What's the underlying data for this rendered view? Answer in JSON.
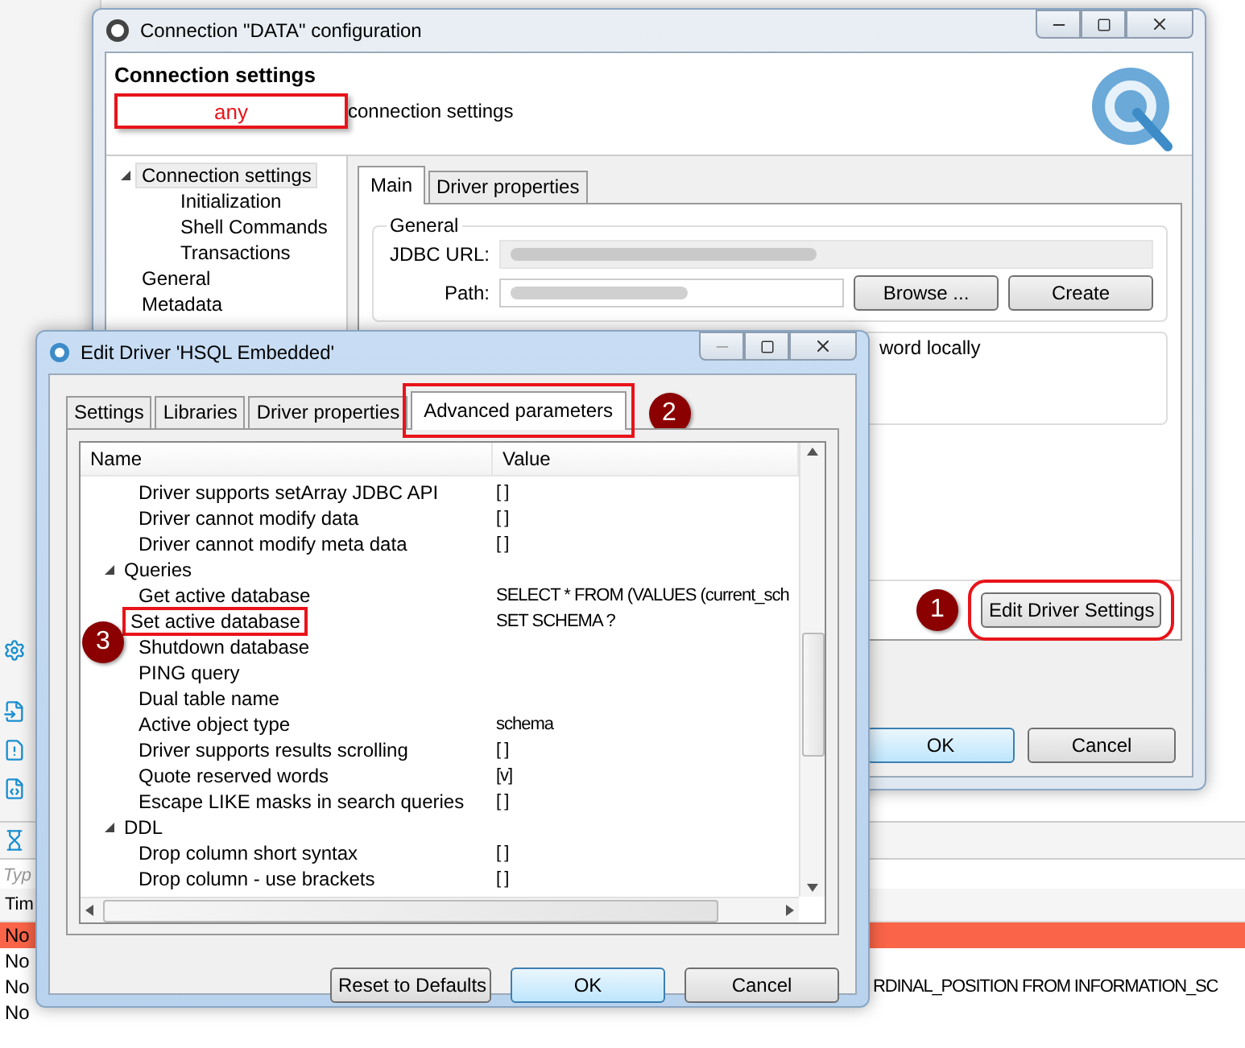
{
  "log_panel": {
    "filter_placeholder": "Typ",
    "columns": [
      "Tim"
    ],
    "rows": [
      {
        "time": "No",
        "query": "",
        "selected": true
      },
      {
        "time": "No",
        "query": "",
        "selected": false
      },
      {
        "time": "No",
        "query": "RDINAL_POSITION FROM INFORMATION_SC",
        "selected": false
      },
      {
        "time": "No",
        "query": "",
        "selected": false
      }
    ]
  },
  "connection_window": {
    "title": "Connection \"DATA\" configuration",
    "header_title": "Connection settings",
    "header_highlight": "any",
    "header_subtitle": "connection settings",
    "nav": [
      {
        "label": "Connection settings",
        "expanded": true,
        "selected": true,
        "children": [
          {
            "label": "Initialization",
            "selected": false
          },
          {
            "label": "Shell Commands",
            "selected": false
          },
          {
            "label": "Transactions",
            "selected": false
          }
        ]
      },
      {
        "label": "General",
        "selected": false
      },
      {
        "label": "Metadata",
        "selected": false
      }
    ],
    "tabs": [
      {
        "label": "Main",
        "selected": true
      },
      {
        "label": "Driver properties",
        "selected": false
      }
    ],
    "general_group": {
      "title": "General",
      "jdbc_label": "JDBC URL:",
      "path_label": "Path:",
      "buttons": [
        "Browse ...",
        "Create"
      ]
    },
    "auth_group_text": "word locally",
    "badge": "1",
    "edit_driver_button": "Edit Driver Settings",
    "buttons": [
      {
        "label": "OK",
        "default": true
      },
      {
        "label": "Cancel",
        "default": false
      }
    ]
  },
  "driver_window": {
    "title": "Edit Driver 'HSQL Embedded'",
    "tabs": [
      {
        "label": "Settings",
        "selected": false,
        "highlighted": false
      },
      {
        "label": "Libraries",
        "selected": false,
        "highlighted": false
      },
      {
        "label": "Driver properties",
        "selected": false,
        "highlighted": false
      },
      {
        "label": "Advanced parameters",
        "selected": true,
        "highlighted": true
      }
    ],
    "tab_badge": "2",
    "row_badge": "3",
    "columns": [
      "Name",
      "Value"
    ],
    "rows": [
      {
        "kind": "item",
        "name": "Driver supports setArray JDBC API",
        "value": "[ ]",
        "highlighted": false
      },
      {
        "kind": "item",
        "name": "Driver cannot modify data",
        "value": "[ ]",
        "highlighted": false
      },
      {
        "kind": "item",
        "name": "Driver cannot modify meta data",
        "value": "[ ]",
        "highlighted": false
      },
      {
        "kind": "group",
        "name": "Queries",
        "value": "",
        "highlighted": false
      },
      {
        "kind": "item",
        "name": "Get active database",
        "value": "SELECT * FROM (VALUES (current_sch",
        "highlighted": false
      },
      {
        "kind": "item",
        "name": "Set active database",
        "value": "SET SCHEMA ?",
        "highlighted": true
      },
      {
        "kind": "item",
        "name": "Shutdown database",
        "value": "",
        "highlighted": false
      },
      {
        "kind": "item",
        "name": "PING query",
        "value": "",
        "highlighted": false
      },
      {
        "kind": "item",
        "name": "Dual table name",
        "value": "",
        "highlighted": false
      },
      {
        "kind": "item",
        "name": "Active object type",
        "value": "schema",
        "highlighted": false
      },
      {
        "kind": "item",
        "name": "Driver supports results scrolling",
        "value": "[ ]",
        "highlighted": false
      },
      {
        "kind": "item",
        "name": "Quote reserved words",
        "value": "[v]",
        "highlighted": false
      },
      {
        "kind": "item",
        "name": "Escape LIKE masks in search queries",
        "value": "[ ]",
        "highlighted": false
      },
      {
        "kind": "group",
        "name": "DDL",
        "value": "",
        "highlighted": false
      },
      {
        "kind": "item",
        "name": "Drop column short syntax",
        "value": "[ ]",
        "highlighted": false
      },
      {
        "kind": "item",
        "name": "Drop column - use brackets",
        "value": "[ ]",
        "highlighted": false
      }
    ],
    "buttons": [
      {
        "label": "Reset to Defaults",
        "default": false
      },
      {
        "label": "OK",
        "default": true
      },
      {
        "label": "Cancel",
        "default": false
      }
    ]
  }
}
